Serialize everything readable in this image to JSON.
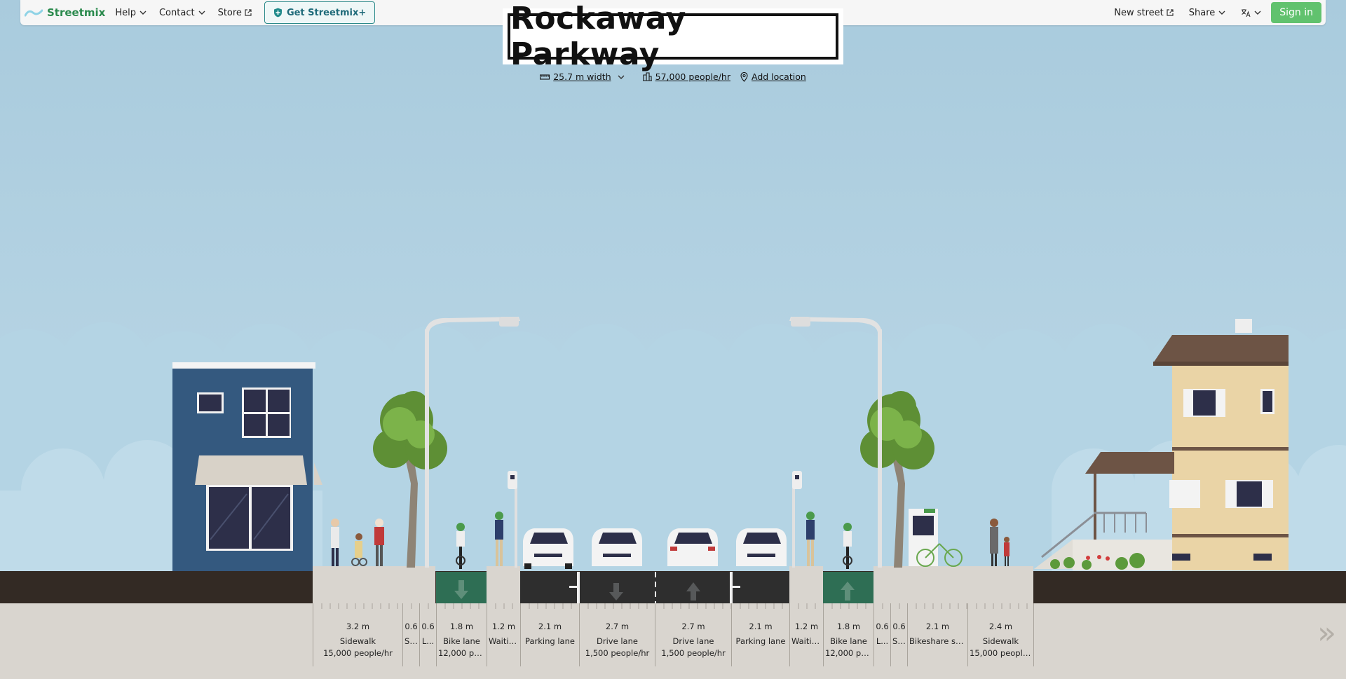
{
  "nav": {
    "logo_text": "Streetmix",
    "help": "Help",
    "contact": "Contact",
    "store": "Store",
    "plus": "Get Streetmix+",
    "new_street": "New street",
    "share": "Share",
    "language_icon": "translate-icon",
    "sign_in": "Sign in"
  },
  "street": {
    "name": "Rockaway Parkway",
    "width": "25.7 m width",
    "capacity": "57,000 people/hr",
    "location": "Add location"
  },
  "colors": {
    "sky": "#a9cbdd",
    "road": "#2e2e2e",
    "bike_lane": "#2e6e54",
    "sidewalk": "#d9d5cf",
    "ground": "#332a24",
    "signin": "#61c26e"
  },
  "segments": [
    {
      "width": "3.2 m",
      "name": "Sidewalk",
      "capacity": "15,000 people/hr"
    },
    {
      "width": "0.6",
      "name": "Si...",
      "capacity": ""
    },
    {
      "width": "0.6",
      "name": "L...",
      "capacity": ""
    },
    {
      "width": "1.8 m",
      "name": "Bike lane",
      "capacity": "12,000 pe..."
    },
    {
      "width": "1.2 m",
      "name": "Waitin...",
      "capacity": ""
    },
    {
      "width": "2.1 m",
      "name": "Parking lane",
      "capacity": ""
    },
    {
      "width": "2.7 m",
      "name": "Drive lane",
      "capacity": "1,500 people/hr"
    },
    {
      "width": "2.7 m",
      "name": "Drive lane",
      "capacity": "1,500 people/hr"
    },
    {
      "width": "2.1 m",
      "name": "Parking lane",
      "capacity": ""
    },
    {
      "width": "1.2 m",
      "name": "Waitin...",
      "capacity": ""
    },
    {
      "width": "1.8 m",
      "name": "Bike lane",
      "capacity": "12,000 pe..."
    },
    {
      "width": "0.6",
      "name": "L...",
      "capacity": ""
    },
    {
      "width": "0.6",
      "name": "Si...",
      "capacity": ""
    },
    {
      "width": "2.1 m",
      "name": "Bikeshare st...",
      "capacity": ""
    },
    {
      "width": "2.4 m",
      "name": "Sidewalk",
      "capacity": "15,000 people/..."
    }
  ],
  "scroll_next": "»"
}
